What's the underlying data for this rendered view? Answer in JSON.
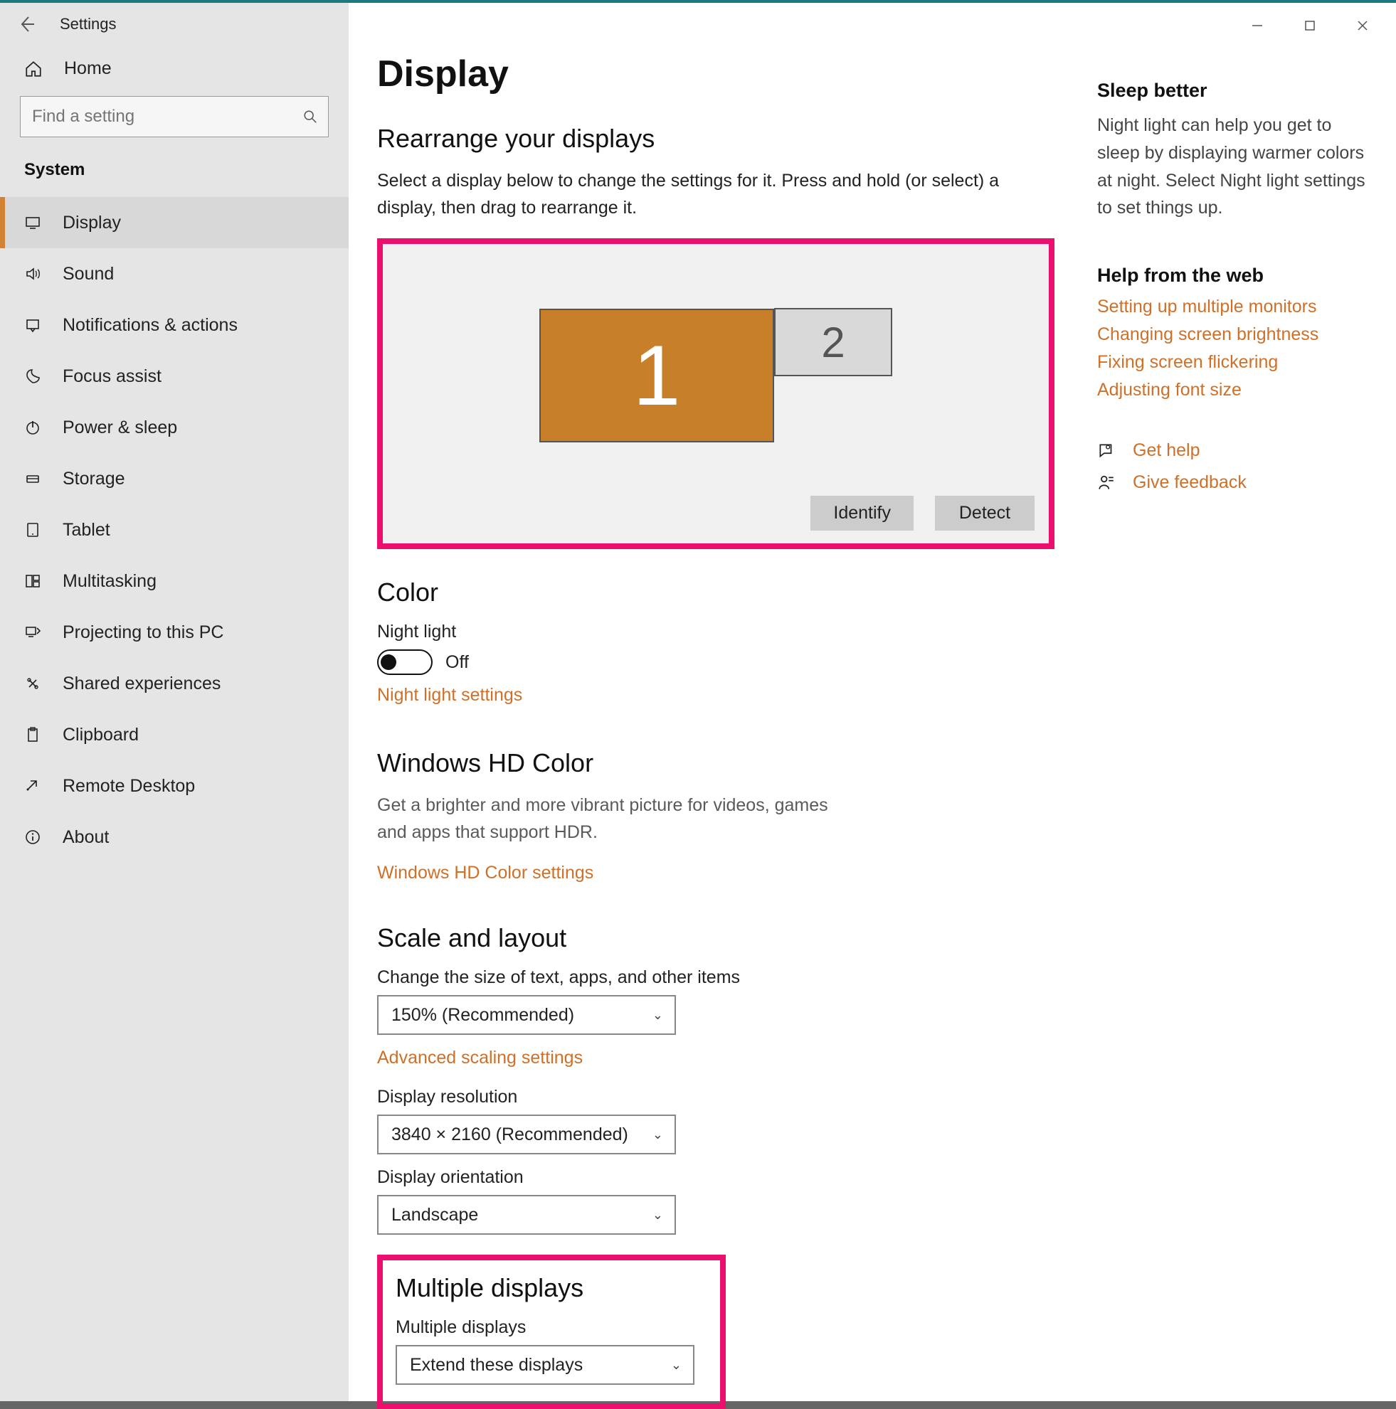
{
  "window": {
    "app_title": "Settings",
    "search_placeholder": "Find a setting",
    "home_label": "Home",
    "category": "System"
  },
  "nav": [
    {
      "icon": "display-icon",
      "label": "Display",
      "active": true
    },
    {
      "icon": "sound-icon",
      "label": "Sound"
    },
    {
      "icon": "notifications-icon",
      "label": "Notifications & actions"
    },
    {
      "icon": "focus-assist-icon",
      "label": "Focus assist"
    },
    {
      "icon": "power-sleep-icon",
      "label": "Power & sleep"
    },
    {
      "icon": "storage-icon",
      "label": "Storage"
    },
    {
      "icon": "tablet-icon",
      "label": "Tablet"
    },
    {
      "icon": "multitasking-icon",
      "label": "Multitasking"
    },
    {
      "icon": "projecting-icon",
      "label": "Projecting to this PC"
    },
    {
      "icon": "shared-experiences-icon",
      "label": "Shared experiences"
    },
    {
      "icon": "clipboard-icon",
      "label": "Clipboard"
    },
    {
      "icon": "remote-desktop-icon",
      "label": "Remote Desktop"
    },
    {
      "icon": "about-icon",
      "label": "About"
    }
  ],
  "page": {
    "title": "Display",
    "rearrange_heading": "Rearrange your displays",
    "rearrange_desc": "Select a display below to change the settings for it. Press and hold (or select) a display, then drag to rearrange it.",
    "monitor1": "1",
    "monitor2": "2",
    "identify_btn": "Identify",
    "detect_btn": "Detect",
    "color_heading": "Color",
    "night_light_label": "Night light",
    "night_light_state": "Off",
    "night_light_link": "Night light settings",
    "hd_heading": "Windows HD Color",
    "hd_desc": "Get a brighter and more vibrant picture for videos, games and apps that support HDR.",
    "hd_link": "Windows HD Color settings",
    "scale_heading": "Scale and layout",
    "scale_size_label": "Change the size of text, apps, and other items",
    "scale_value": "150% (Recommended)",
    "adv_scaling_link": "Advanced scaling settings",
    "resolution_label": "Display resolution",
    "resolution_value": "3840 × 2160 (Recommended)",
    "orientation_label": "Display orientation",
    "orientation_value": "Landscape",
    "md_heading": "Multiple displays",
    "md_label": "Multiple displays",
    "md_value": "Extend these displays"
  },
  "aside": {
    "sleep_heading": "Sleep better",
    "sleep_desc": "Night light can help you get to sleep by displaying warmer colors at night. Select Night light settings to set things up.",
    "help_heading": "Help from the web",
    "links": {
      "l1": "Setting up multiple monitors",
      "l2": "Changing screen brightness",
      "l3": "Fixing screen flickering",
      "l4": "Adjusting font size"
    },
    "get_help": "Get help",
    "give_feedback": "Give feedback"
  }
}
